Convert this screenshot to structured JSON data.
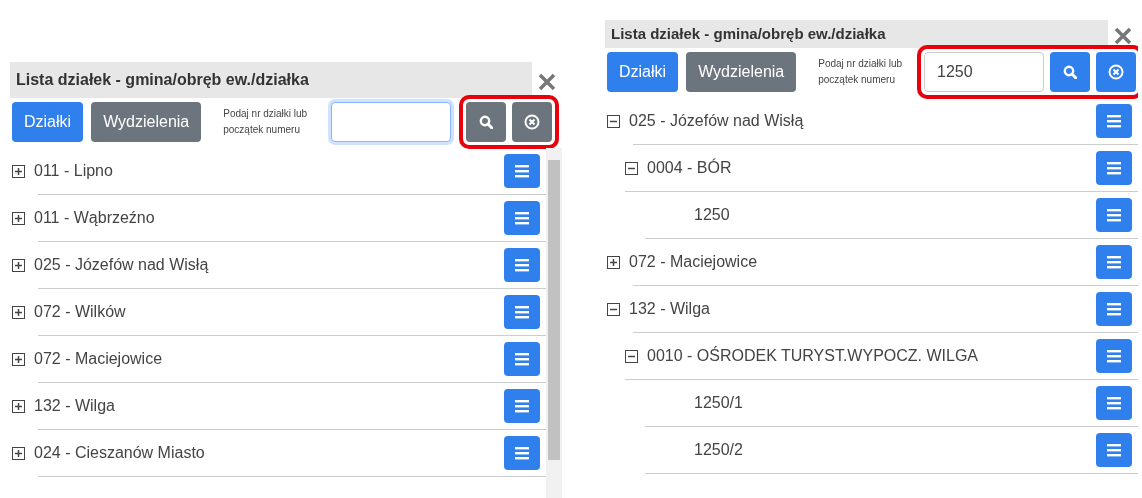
{
  "panels": [
    {
      "title": "Lista działek - gmina/obręb ew./działka",
      "tabs": [
        {
          "label": "Działki",
          "selected": true
        },
        {
          "label": "Wydzielenia",
          "selected": false
        }
      ],
      "search_label": "Podaj nr działki lub początek numeru",
      "search": {
        "focused": true
      },
      "search_enabled": false,
      "highlight_field": false,
      "highlight_buttons": true,
      "scrollbar": true,
      "tree": [
        {
          "kind": "group",
          "label": "011 - Lipno",
          "expanded": false
        },
        {
          "kind": "group",
          "label": "011 - Wąbrzeźno",
          "expanded": false
        },
        {
          "kind": "group",
          "label": "025 - Józefów nad Wisłą",
          "expanded": false
        },
        {
          "kind": "group",
          "label": "072 - Wilków",
          "expanded": false
        },
        {
          "kind": "group",
          "label": "072 - Maciejowice",
          "expanded": false
        },
        {
          "kind": "group",
          "label": "132 - Wilga",
          "expanded": false
        },
        {
          "kind": "group",
          "label": "024 - Cieszanów Miasto",
          "expanded": false
        }
      ]
    },
    {
      "title": "Lista działek - gmina/obręb ew./działka",
      "tabs": [
        {
          "label": "Działki",
          "selected": true
        },
        {
          "label": "Wydzielenia",
          "selected": false
        }
      ],
      "search_label": "Podaj nr działki lub początek numeru",
      "search": {
        "value": "1250",
        "focused": false
      },
      "search_enabled": true,
      "highlight_field": true,
      "highlight_buttons": true,
      "scrollbar": false,
      "tree": [
        {
          "kind": "group",
          "label": "025 - Józefów nad Wisłą",
          "expanded": true,
          "children": [
            {
              "kind": "group",
              "label": "0004 - BÓR",
              "expanded": true,
              "children": [
                {
                  "kind": "parcel",
                  "label": "1250"
                }
              ]
            }
          ]
        },
        {
          "kind": "group",
          "label": "072 - Maciejowice",
          "expanded": false
        },
        {
          "kind": "group",
          "label": "132 - Wilga",
          "expanded": true,
          "children": [
            {
              "kind": "group",
              "label": "0010 - OŚRODEK TURYST.WYPOCZ. WILGA",
              "expanded": true,
              "children": [
                {
                  "kind": "parcel",
                  "label": "1250/1"
                },
                {
                  "kind": "parcel",
                  "label": "1250/2"
                }
              ]
            }
          ]
        }
      ]
    }
  ]
}
